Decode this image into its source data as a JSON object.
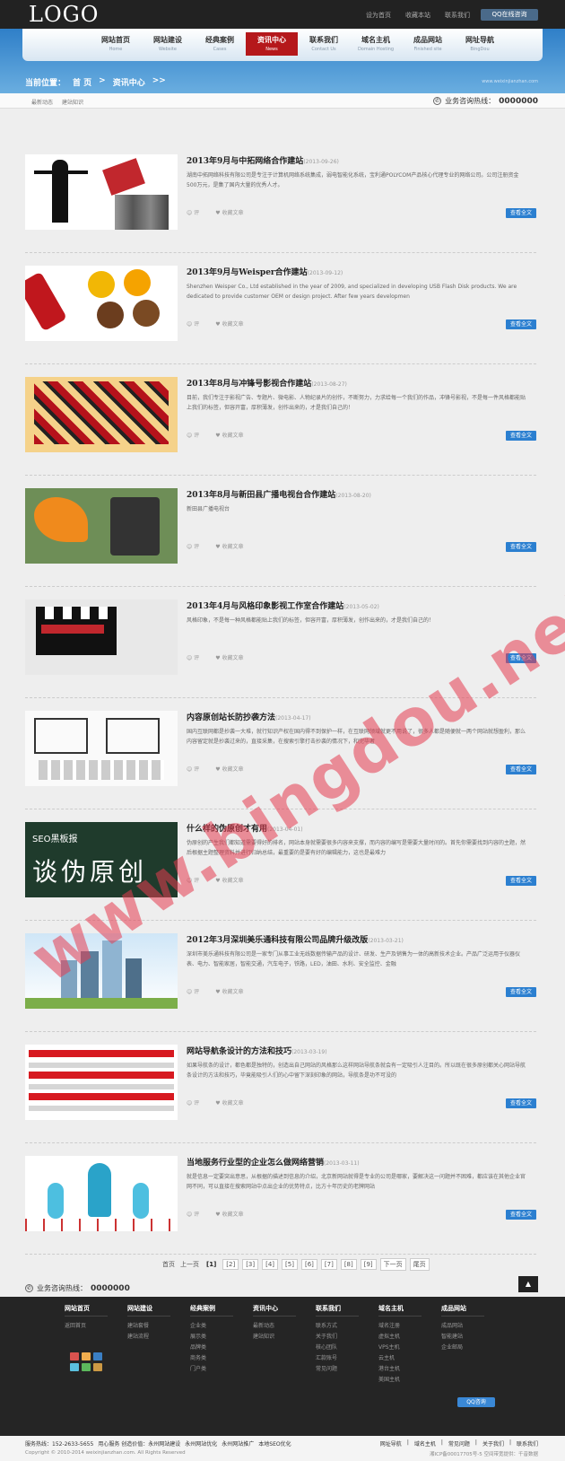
{
  "header": {
    "logo": "LOGO",
    "links": [
      "设为首页",
      "收藏本站",
      "联系我们"
    ],
    "qq_button": "QQ在线咨询"
  },
  "nav": [
    {
      "cn": "网站首页",
      "en": "Home"
    },
    {
      "cn": "网站建设",
      "en": "Website"
    },
    {
      "cn": "经典案例",
      "en": "Cases"
    },
    {
      "cn": "资讯中心",
      "en": "News",
      "active": true
    },
    {
      "cn": "联系我们",
      "en": "Contact Us"
    },
    {
      "cn": "域名主机",
      "en": "Domain Hosting"
    },
    {
      "cn": "成品网站",
      "en": "Finished site"
    },
    {
      "cn": "网址导航",
      "en": "BingDou"
    }
  ],
  "breadcrumb": {
    "label": "当前位置：",
    "home": "首 页",
    "sep": ">",
    "current": "资讯中心",
    "arrows": ">>"
  },
  "site_url": "www.weixinjianzhan.com",
  "subnav": [
    "最新动态",
    "建站知识"
  ],
  "hotline": {
    "label": "业务咨询热线：",
    "number": "0000000"
  },
  "articles": [
    {
      "title": "2013年9月与中拓网络合作建站",
      "date": "(2013-09-26)",
      "desc": "湖南中拓网络科技有限公司是专注于计算机网络系统集成，弱电智能化系统，宝利通POLYCOM产品核心代理专业的网络公司。公司注册资金500万元，是集了国内大量的优秀人才。"
    },
    {
      "title": "2013年9月与Weisper合作建站",
      "date": "(2013-09-12)",
      "desc": "Shenzhen Weisper Co., Ltd established in the year of 2009, and specialized in developing USB Flash Disk products. We are dedicated to provide customer OEM or design project. After few years developmen"
    },
    {
      "title": "2013年8月与冲锋号影视合作建站",
      "date": "(2013-08-27)",
      "desc": "目前，我们专注于影视广告、专题片、微电影、人物纪录片的创作，不断努力，力求给每一个我们的作品，冲锋号影视，不是每一件风格都能贴上我们的标签，但容开富，厚积薄发，创作出来的，才是我们自己的！"
    },
    {
      "title": "2013年8月与新田县广播电视台合作建站",
      "date": "(2013-08-20)",
      "desc": "新田县广播电视台"
    },
    {
      "title": "2013年4月与风格印象影视工作室合作建站",
      "date": "(2013-05-02)",
      "desc": "风格印象，不是每一种风格都能贴上我们的标签，但容开富，厚积薄发，创作出来的，才是我们自己的！"
    },
    {
      "title": "内容原创站长防抄袭方法",
      "date": "(2013-04-17)",
      "desc": "国内互联网都是抄袭一大堆，就行知识产权在国内得不到保护一样，在互联网领域就更不用说了，很多人都是随便就一两个网站就想盈利，那么内容留定就是抄袭过来的，直接采集，在搜索引擎打击抄袭的情况下，和完毕者"
    },
    {
      "title": "什么样的伪原创才有用",
      "date": "(2013-04-01)",
      "desc": "伪原创的产生我们都知道需要得好的排名，网站本身就需要很多内容来支撑，而内容的编写是需要大量时间的。首先你需要找到内容的主题，然后根据主题整理资料并进行归纳总结，最重要的是要有好的编辑能力，这也是最难力"
    },
    {
      "title": "2012年3月深圳美乐通科技有限公司品牌升级改版",
      "date": "(2013-03-21)",
      "desc": "深圳市美乐通科技有限公司是一家专门从事工业无线数据传输产品的设计、研发、生产及销售为一体的高新技术企业。产品广泛运用于仪器仪表、电力、智能家居，智能交通，汽车电子，铁路，LED，油田、水利、安全监控、金融"
    },
    {
      "title": "网站导航条设计的方法和技巧",
      "date": "(2013-03-19)",
      "desc": "如果导航条的设计，都色都是独特的，创造出自己网站的风格那么这样网站导航条就会有一定吸引人注目的。所以既在很多原创都关心网站导航条设计的方法和技巧，毕竟能吸引人们的心中留下深刻印象的网站，导航条是功不可没的"
    },
    {
      "title": "当地服务行业型的企业怎么做网络营销",
      "date": "(2013-03-11)",
      "desc": "就是信息一定要突出意思，从根据的描述到信息的介绍，北京新网站就得是专业的公司是哪家，要解决这一问题并不困难，都应该在其他企业官网不同，可以直接在搜索网站中点出企业的优势特点，比方十年历史的老牌网站"
    }
  ],
  "article_meta": {
    "comments": "评",
    "favorite": "收藏文章",
    "view_button": "查看全文"
  },
  "pagination": {
    "first": "首页",
    "prev": "上一页",
    "pages": [
      "[1]",
      "[2]",
      "[3]",
      "[4]",
      "[5]",
      "[6]",
      "[7]",
      "[8]",
      "[9]"
    ],
    "next": "下一页",
    "last": "尾页"
  },
  "footer": {
    "columns": [
      {
        "title": "网站首页",
        "items": [
          "返回首页"
        ]
      },
      {
        "title": "网站建设",
        "items": [
          "建站套餐",
          "建站流程"
        ]
      },
      {
        "title": "经典案例",
        "items": [
          "企业类",
          "展示类",
          "品牌类",
          "商务类",
          "门户类"
        ]
      },
      {
        "title": "资讯中心",
        "items": [
          "最新动态",
          "建站知识"
        ]
      },
      {
        "title": "联系我们",
        "items": [
          "联系方式",
          "关于我们",
          "核心团队",
          "汇款账号",
          "常见问题"
        ]
      },
      {
        "title": "域名主机",
        "items": [
          "域名注册",
          "虚拟主机",
          "VPS主机",
          "云主机",
          "港台主机",
          "美国主机"
        ]
      },
      {
        "title": "成品网站",
        "items": [
          "成品网站",
          "智能建站",
          "企业邮局"
        ]
      }
    ],
    "qq": "QQ咨询"
  },
  "copyright": {
    "service": "服务热线：152-2633-5655",
    "links": [
      "用心服务 创造价值：永州网站建设",
      "永州网站优化",
      "永州网站推广",
      "本地SEO优化"
    ],
    "right_links": [
      "网址导航",
      "域名主机",
      "常见问题",
      "关于我们",
      "联系我们"
    ],
    "copy": "Copyright © 2010-2014 weixinjianzhan.com. All Rights Reserved",
    "icp": "湘ICP备00017705号-5    空间带宽提供：千音数据"
  },
  "watermark": "www.bingdou.net"
}
